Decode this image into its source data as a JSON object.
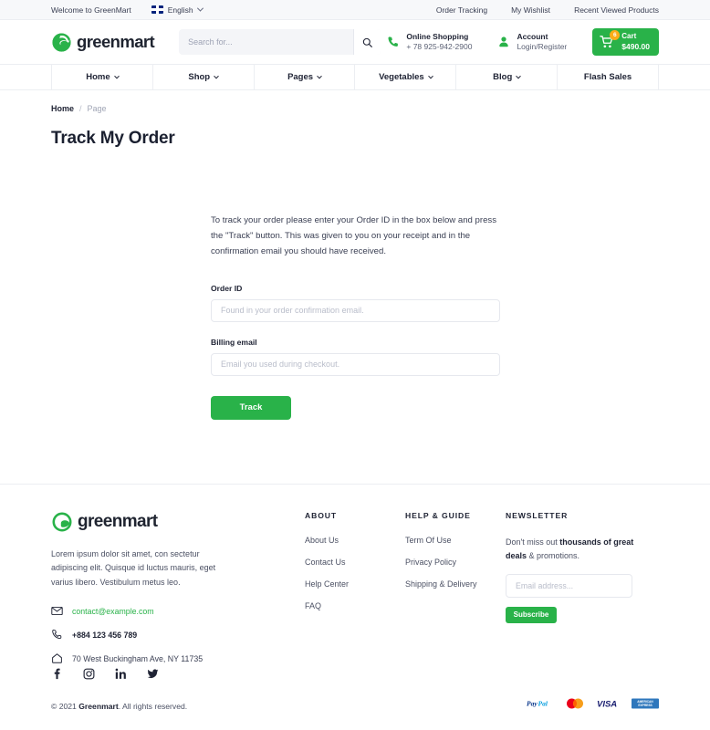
{
  "topbar": {
    "welcome": "Welcome to GreenMart",
    "language": "English",
    "language_flag_icon": "uk-flag-icon",
    "chevron_icon": "chevron-down-icon",
    "links": [
      "Order Tracking",
      "My Wishlist",
      "Recent Viewed Products"
    ]
  },
  "header": {
    "logo_text": "greenmart",
    "logo_icon": "greenmart-leaf-logo-icon",
    "search": {
      "placeholder": "Search for...",
      "value": "",
      "icon": "search-icon"
    },
    "phone": {
      "icon": "phone-icon",
      "title": "Online Shopping",
      "number": "+ 78 925-942-2900"
    },
    "account": {
      "icon": "user-icon",
      "title": "Account",
      "subtitle": "Login/Register"
    },
    "cart": {
      "icon": "shopping-cart-icon",
      "count": "6",
      "label": "Cart",
      "total": "$490.00"
    }
  },
  "nav": {
    "items": [
      {
        "label": "Home",
        "has_dropdown": true
      },
      {
        "label": "Shop",
        "has_dropdown": true
      },
      {
        "label": "Pages",
        "has_dropdown": true
      },
      {
        "label": "Vegetables",
        "has_dropdown": true
      },
      {
        "label": "Blog",
        "has_dropdown": true
      },
      {
        "label": "Flash Sales",
        "has_dropdown": false
      }
    ]
  },
  "breadcrumb": {
    "home": "Home",
    "separator": "/",
    "current": "Page"
  },
  "page": {
    "title": "Track My Order"
  },
  "form": {
    "intro": "To track your order please enter your Order ID in the box below and press the \"Track\" button. This was given to you on your receipt and in the confirmation email you should have received.",
    "order_id_label": "Order ID",
    "order_id_placeholder": "Found in your order confirmation email.",
    "order_id_value": "",
    "billing_email_label": "Billing email",
    "billing_email_placeholder": "Email you used during checkout.",
    "billing_email_value": "",
    "submit_label": "Track"
  },
  "footer": {
    "logo_text": "greenmart",
    "logo_icon": "greenmart-leaf-logo-icon",
    "description": "Lorem ipsum dolor sit amet, con sectetur adipiscing elit. Quisque id luctus mauris, eget varius libero. Vestibulum metus leo.",
    "email": "contact@example.com",
    "email_icon": "envelope-icon",
    "phone": "+884 123 456 789",
    "phone_icon": "phone-icon",
    "address": "70 West Buckingham Ave, NY 11735",
    "address_icon": "home-icon",
    "about": {
      "heading": "ABOUT",
      "links": [
        "About Us",
        "Contact Us",
        "Help Center",
        "FAQ"
      ]
    },
    "help": {
      "heading": "HELP & GUIDE",
      "links": [
        "Term Of Use",
        "Privacy Policy",
        "Shipping & Delivery"
      ]
    },
    "newsletter": {
      "heading": "NEWSLETTER",
      "text_1": "Don't miss out ",
      "text_bold": "thousands of great deals",
      "text_2": " & promotions.",
      "placeholder": "Email address...",
      "value": "",
      "button": "Subscribe"
    },
    "socials": [
      {
        "name": "facebook-icon"
      },
      {
        "name": "instagram-icon"
      },
      {
        "name": "linkedin-icon"
      },
      {
        "name": "twitter-icon"
      }
    ],
    "copyright_prefix": "© 2021 ",
    "copyright_brand": "Greenmart",
    "copyright_suffix": ". All rights reserved.",
    "payments": [
      "PayPal",
      "Mastercard",
      "VISA",
      "American Express"
    ]
  },
  "colors": {
    "brand_green": "#29b249",
    "badge_orange": "#fbad18",
    "text_dark": "#202435",
    "text_muted": "#4b5063",
    "topbar_bg": "#f7f8fa",
    "border": "#eceef2"
  }
}
